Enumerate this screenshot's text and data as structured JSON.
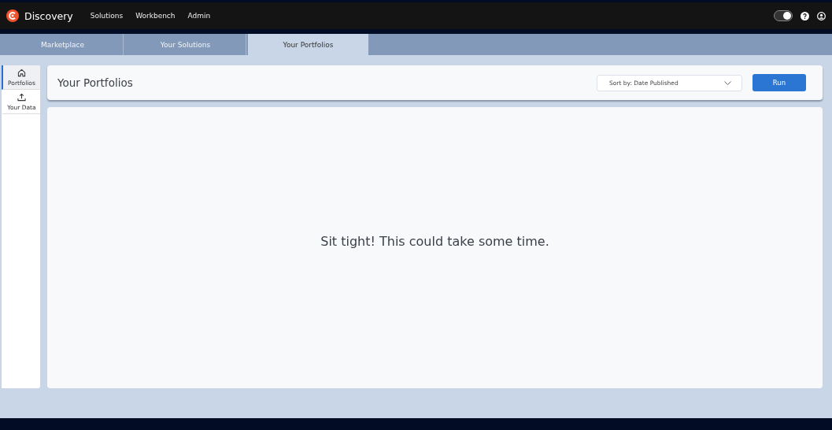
{
  "app": {
    "name": "Discovery"
  },
  "nav_links": [
    "Solutions",
    "Workbench",
    "Admin"
  ],
  "theme_toggle": {
    "on": true
  },
  "tabs": [
    {
      "label": "Marketplace",
      "selected": false
    },
    {
      "label": "Your Solutions",
      "selected": false
    },
    {
      "label": "Your Portfolios",
      "selected": true
    }
  ],
  "sidebar": {
    "items": [
      {
        "label": "Portfolios",
        "kind": "home",
        "selected": true
      },
      {
        "label": "Your Data",
        "kind": "upload",
        "selected": false
      }
    ]
  },
  "page": {
    "title": "Your Portfolios",
    "sort": {
      "value": "Sort by: Date Published"
    },
    "run_button": "Run",
    "message": "Sit tight! This could take some time."
  }
}
